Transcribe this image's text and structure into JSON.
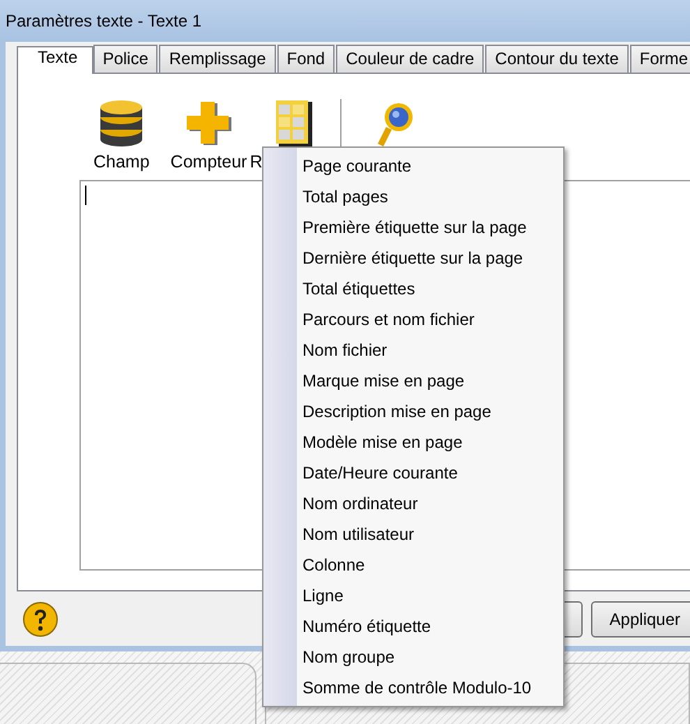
{
  "window": {
    "title": "Paramètres texte - Texte 1"
  },
  "tabs": [
    {
      "label": "Texte",
      "selected": true
    },
    {
      "label": "Police",
      "selected": false
    },
    {
      "label": "Remplissage",
      "selected": false
    },
    {
      "label": "Fond",
      "selected": false
    },
    {
      "label": "Couleur de cadre",
      "selected": false
    },
    {
      "label": "Contour du texte",
      "selected": false
    },
    {
      "label": "Forme",
      "selected": false
    }
  ],
  "toolbar": [
    {
      "kind": "database",
      "label": "Champ"
    },
    {
      "kind": "plus",
      "label": "Compteur"
    },
    {
      "kind": "grid",
      "label": "R"
    },
    {
      "kind": "separator"
    },
    {
      "kind": "magnifier"
    }
  ],
  "buttons": [
    {
      "label": "Appliquer"
    }
  ],
  "menu": [
    "Page courante",
    "Total pages",
    "Première étiquette sur la page",
    "Dernière étiquette sur la page",
    "Total étiquettes",
    "Parcours et nom fichier",
    "Nom fichier",
    "Marque mise en page",
    "Description mise en page",
    "Modèle mise en page",
    "Date/Heure courante",
    "Nom ordinateur",
    "Nom utilisateur",
    "Colonne",
    "Ligne",
    "Numéro étiquette",
    "Nom groupe",
    "Somme de contrôle Modulo-10"
  ]
}
